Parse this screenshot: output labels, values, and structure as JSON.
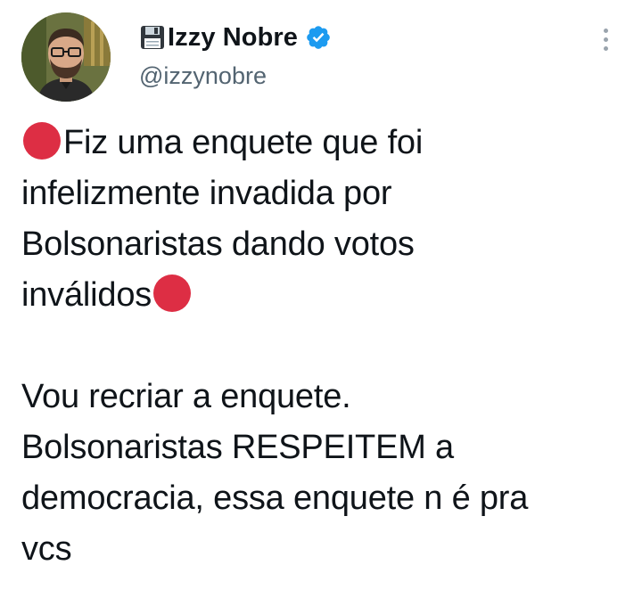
{
  "author": {
    "display_name": "Izzy Nobre",
    "handle": "@izzynobre",
    "avatar_icon": "profile-photo",
    "name_prefix_icon": "floppy-disk-icon",
    "verified_icon": "verified-badge-icon",
    "verified_color": "#1d9bf0"
  },
  "menu": {
    "icon": "more-vertical-icon"
  },
  "tweet": {
    "paragraph1": {
      "line1": "Fiz uma enquete que foi",
      "line2": "infelizmente invadida por",
      "line3": "Bolsonaristas dando votos",
      "line4": "inválidos"
    },
    "paragraph2": {
      "line1": "Vou recriar a enquete.",
      "line2": "Bolsonaristas RESPEITEM a",
      "line3": "democracia, essa enquete n é pra",
      "line4": "vcs"
    },
    "emoji": "red-circle-icon",
    "emoji_color": "#dd2e44"
  }
}
